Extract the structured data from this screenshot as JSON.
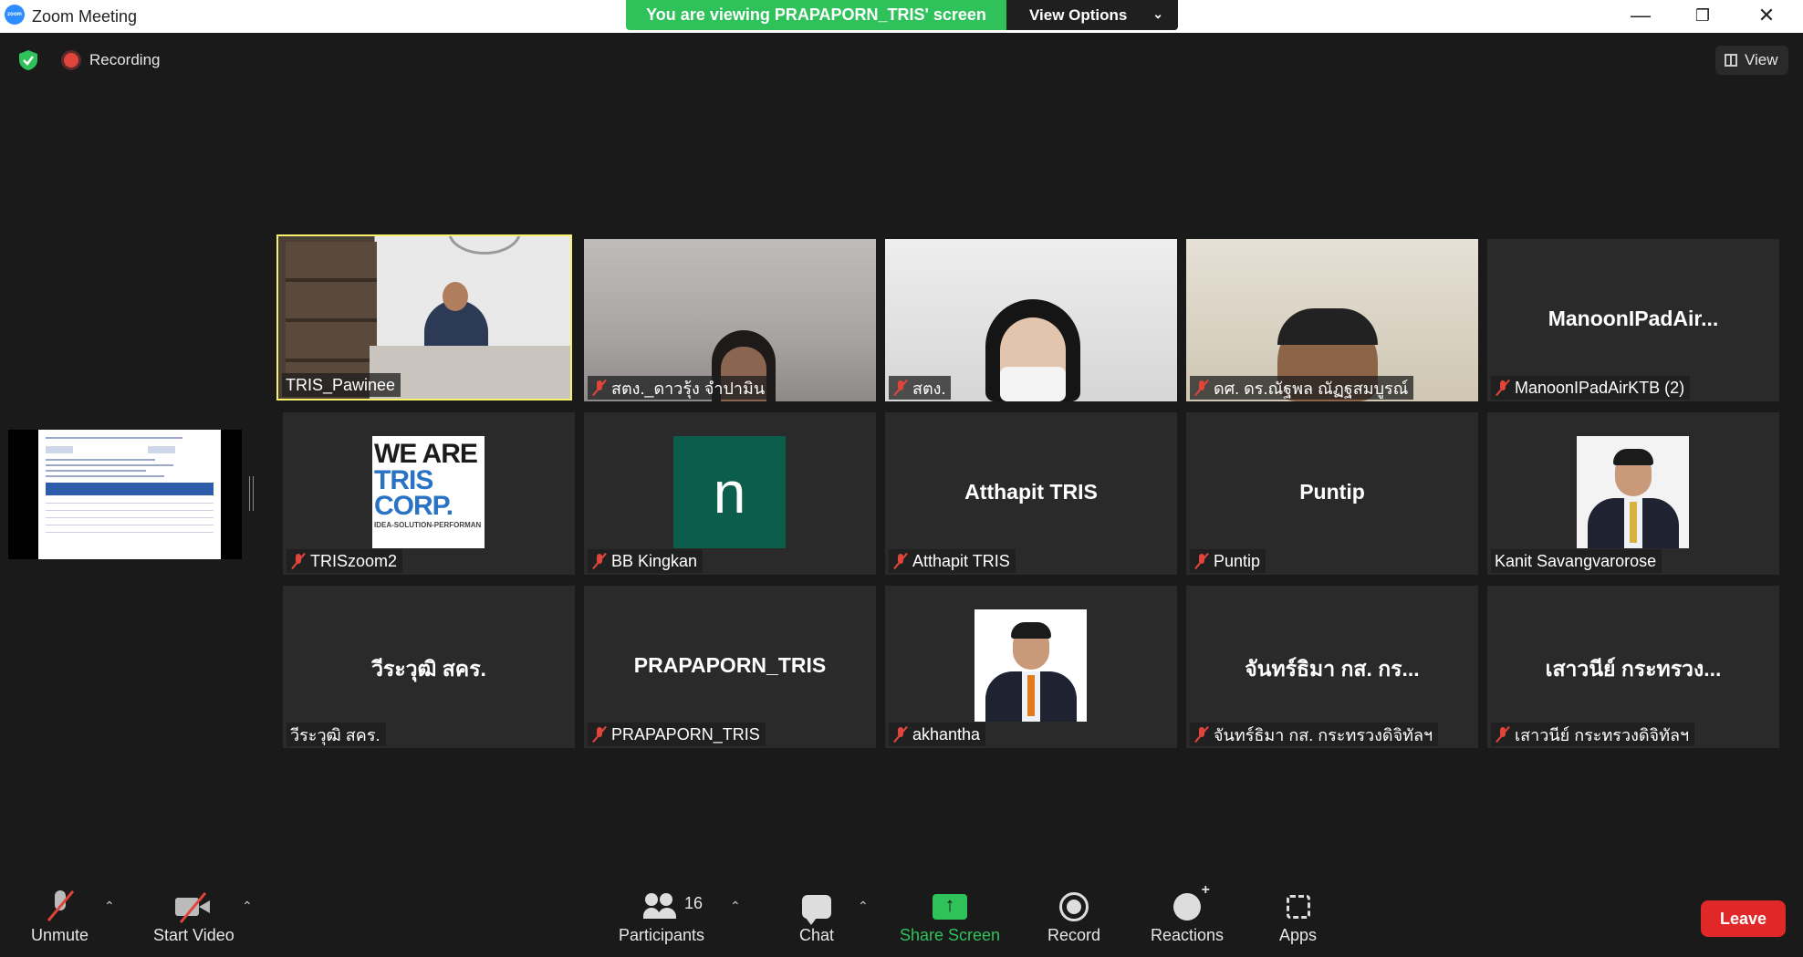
{
  "window": {
    "title": "Zoom Meeting",
    "minimize": "—",
    "restore": "❐",
    "close": "✕"
  },
  "banner": {
    "viewing_text": "You are viewing PRAPAPORN_TRIS' screen",
    "view_options": "View Options"
  },
  "top": {
    "recording_label": "Recording",
    "view_label": "View"
  },
  "tiles": [
    {
      "name": "TRIS_Pawinee",
      "display": "",
      "muted": false,
      "kind": "video-office",
      "active": true
    },
    {
      "name": "สตง._ดาวรุ้ง จำปามิน",
      "display": "",
      "muted": true,
      "kind": "video-ceiling"
    },
    {
      "name": "สตง.",
      "display": "",
      "muted": true,
      "kind": "video-white"
    },
    {
      "name": "ดศ. ดร.ณัฐพล ณัฏฐสมบูรณ์",
      "display": "",
      "muted": true,
      "kind": "video-beige"
    },
    {
      "name": "ManoonIPadAirKTB (2)",
      "display": "ManoonIPadAir...",
      "muted": true,
      "kind": "name"
    },
    {
      "name": "TRISzoom2",
      "display": "",
      "muted": true,
      "kind": "logo-tris"
    },
    {
      "name": "BB Kingkan",
      "display": "n",
      "muted": true,
      "kind": "avatar"
    },
    {
      "name": "Atthapit TRIS",
      "display": "Atthapit TRIS",
      "muted": true,
      "kind": "name"
    },
    {
      "name": "Puntip",
      "display": "Puntip",
      "muted": true,
      "kind": "name"
    },
    {
      "name": "Kanit Savangvarorose",
      "display": "",
      "muted": false,
      "kind": "photo"
    },
    {
      "name": "วีระวุฒิ สคร.",
      "display": "วีระวุฒิ สคร.",
      "muted": false,
      "kind": "name"
    },
    {
      "name": "PRAPAPORN_TRIS",
      "display": "PRAPAPORN_TRIS",
      "muted": true,
      "kind": "name"
    },
    {
      "name": "akhantha",
      "display": "",
      "muted": true,
      "kind": "photo2"
    },
    {
      "name": "จันทร์ธิมา กส. กระทรวงดิจิทัลฯ",
      "display": "จันทร์ธิมา กส. กร...",
      "muted": true,
      "kind": "name"
    },
    {
      "name": "เสาวนีย์ กระทรวงดิจิทัลฯ",
      "display": "เสาวนีย์ กระทรวง...",
      "muted": true,
      "kind": "name"
    }
  ],
  "logo_tris": {
    "line1": "WE ARE",
    "line2": "TRIS",
    "line3": "CORP.",
    "tagline": "IDEA-SOLUTION-PERFORMAN"
  },
  "toolbar": {
    "unmute": "Unmute",
    "start_video": "Start Video",
    "participants": "Participants",
    "participants_count": "16",
    "chat": "Chat",
    "share_screen": "Share Screen",
    "record": "Record",
    "reactions": "Reactions",
    "apps": "Apps",
    "leave": "Leave",
    "caret": "⌃"
  },
  "colors": {
    "banner_green": "#2fc25b",
    "active_speaker": "#f7f06a",
    "leave_red": "#e02828",
    "muted_red": "#e0453b"
  }
}
